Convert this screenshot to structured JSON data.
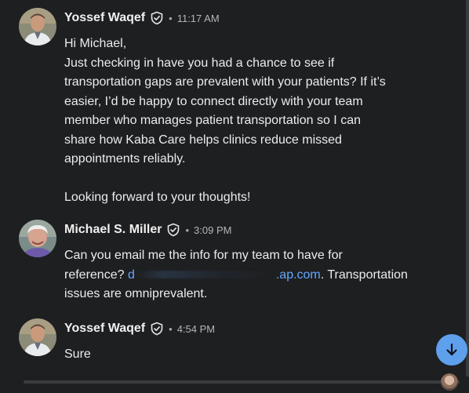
{
  "messages": [
    {
      "author": "Yossef Waqef",
      "time": "11:17 AM",
      "lines": [
        "Hi Michael,",
        "Just checking in have you had a chance to see if",
        "transportation gaps are prevalent with your patients? If it’s",
        "easier, I’d be happy to connect directly with your team",
        "member who manages patient transportation so I can",
        "share how Kaba Care helps clinics reduce missed",
        "appointments reliably.",
        "",
        "Looking forward to your thoughts!"
      ]
    },
    {
      "author": "Michael S. Miller",
      "time": "3:09 PM",
      "line1": "Can you email me the info for my team to have for",
      "line2_prefix": "reference? ",
      "email_start": "d",
      "email_end": ".ap.com",
      "line2_suffix": ". Transportation",
      "line3": "issues are omniprevalent."
    },
    {
      "author": "Yossef Waqef",
      "time": "4:54 PM",
      "text": "Sure"
    }
  ],
  "separator": "•",
  "icons": {
    "verified": "verified-shield-icon",
    "scroll_down": "arrow-down-icon"
  },
  "colors": {
    "background": "#1e1f21",
    "link": "#64a8ff",
    "scroll_button": "#5ea0ec"
  }
}
